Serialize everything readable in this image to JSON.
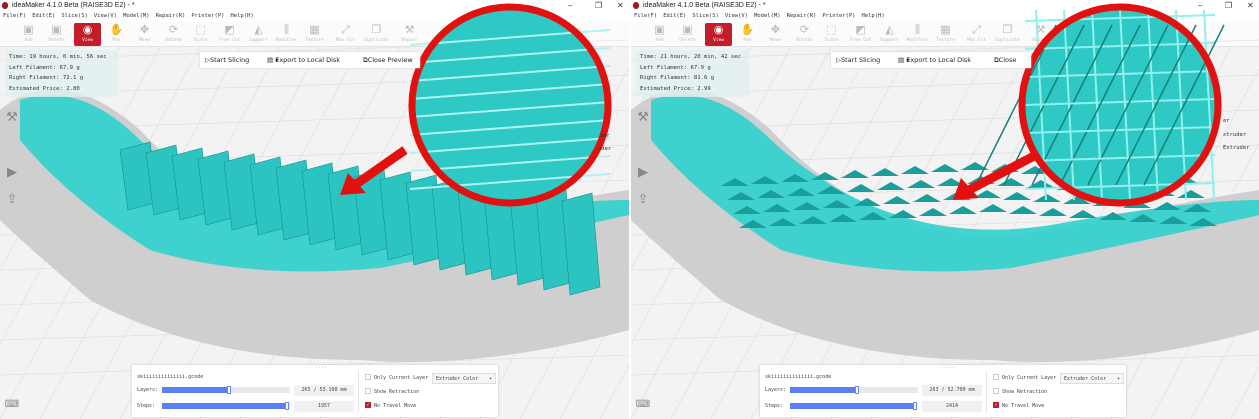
{
  "panels": [
    {
      "window_title": "ideaMaker 4.1.0 Beta (RAISE3D E2) - *",
      "menu": [
        "File(F)",
        "Edit(E)",
        "Slice(S)",
        "View(V)",
        "Model(M)",
        "Repair(R)",
        "Printer(P)",
        "Help(H)"
      ],
      "toolbar": [
        "Add",
        "Delete",
        "View",
        "Pan",
        "Move",
        "Rotate",
        "Scale",
        "Free Cut",
        "Support",
        "Modifier",
        "Texture",
        "Max Fit",
        "Duplicate",
        "Repair"
      ],
      "stats": {
        "time": "Time: 19 hours, 0 min, 56 sec",
        "left": "Left Filament: 67.9 g",
        "right": "Right Filament: 72.1 g",
        "price": "Estimated Price: 2.80"
      },
      "actions": {
        "start": "Start Slicing",
        "export": "Export to Local Disk",
        "close": "Close Preview"
      },
      "extruder_labels": [
        "der",
        "uder"
      ],
      "bottom": {
        "file": "skiiiiiiiiiiiiii.gcode",
        "layers_label": "Layers:",
        "layers_value": "265 / 53.100 mm",
        "layers_fraction": 0.52,
        "steps_label": "Steps:",
        "steps_value": "1957",
        "steps_fraction": 0.98,
        "only_current": "Only Current Layer",
        "show_retraction": "Show Retraction",
        "no_travel": "No Travel Move",
        "color_mode": "Extruder Color"
      }
    },
    {
      "window_title": "ideaMaker 4.1.0 Beta (RAISE3D E2) - *",
      "menu": [
        "File(F)",
        "Edit(E)",
        "Slice(S)",
        "View(V)",
        "Model(M)",
        "Repair(R)",
        "Printer(P)",
        "Help(H)"
      ],
      "toolbar": [
        "Add",
        "Delete",
        "View",
        "Pan",
        "Move",
        "Rotate",
        "Scale",
        "Free Cut",
        "Support",
        "Modifier",
        "Texture",
        "Max Fit",
        "Duplicate",
        "Repair"
      ],
      "stats": {
        "time": "Time: 21 hours, 20 min, 42 sec",
        "left": "Left Filament: 67.9 g",
        "right": "Right Filament: 81.6 g",
        "price": "Estimated Price: 2.99"
      },
      "actions": {
        "start": "Start Slicing",
        "export": "Export to Local Disk",
        "close": "Close"
      },
      "extruder_labels": [
        "er",
        "xtruder",
        "Extruder"
      ],
      "bottom": {
        "file": "skiiiiiiiiiiiiii.gcode",
        "layers_label": "Layers:",
        "layers_value": "263 / 52.700 mm",
        "layers_fraction": 0.52,
        "steps_label": "Steps:",
        "steps_value": "2414",
        "steps_fraction": 0.98,
        "only_current": "Only Current Layer",
        "show_retraction": "Show Retraction",
        "no_travel": "No Travel Move",
        "color_mode": "Extruder Color"
      }
    }
  ],
  "colors": {
    "accent": "#c21d28",
    "model": "#2fd0cc",
    "slider": "#5b7ff2",
    "highlight": "#e31010"
  }
}
